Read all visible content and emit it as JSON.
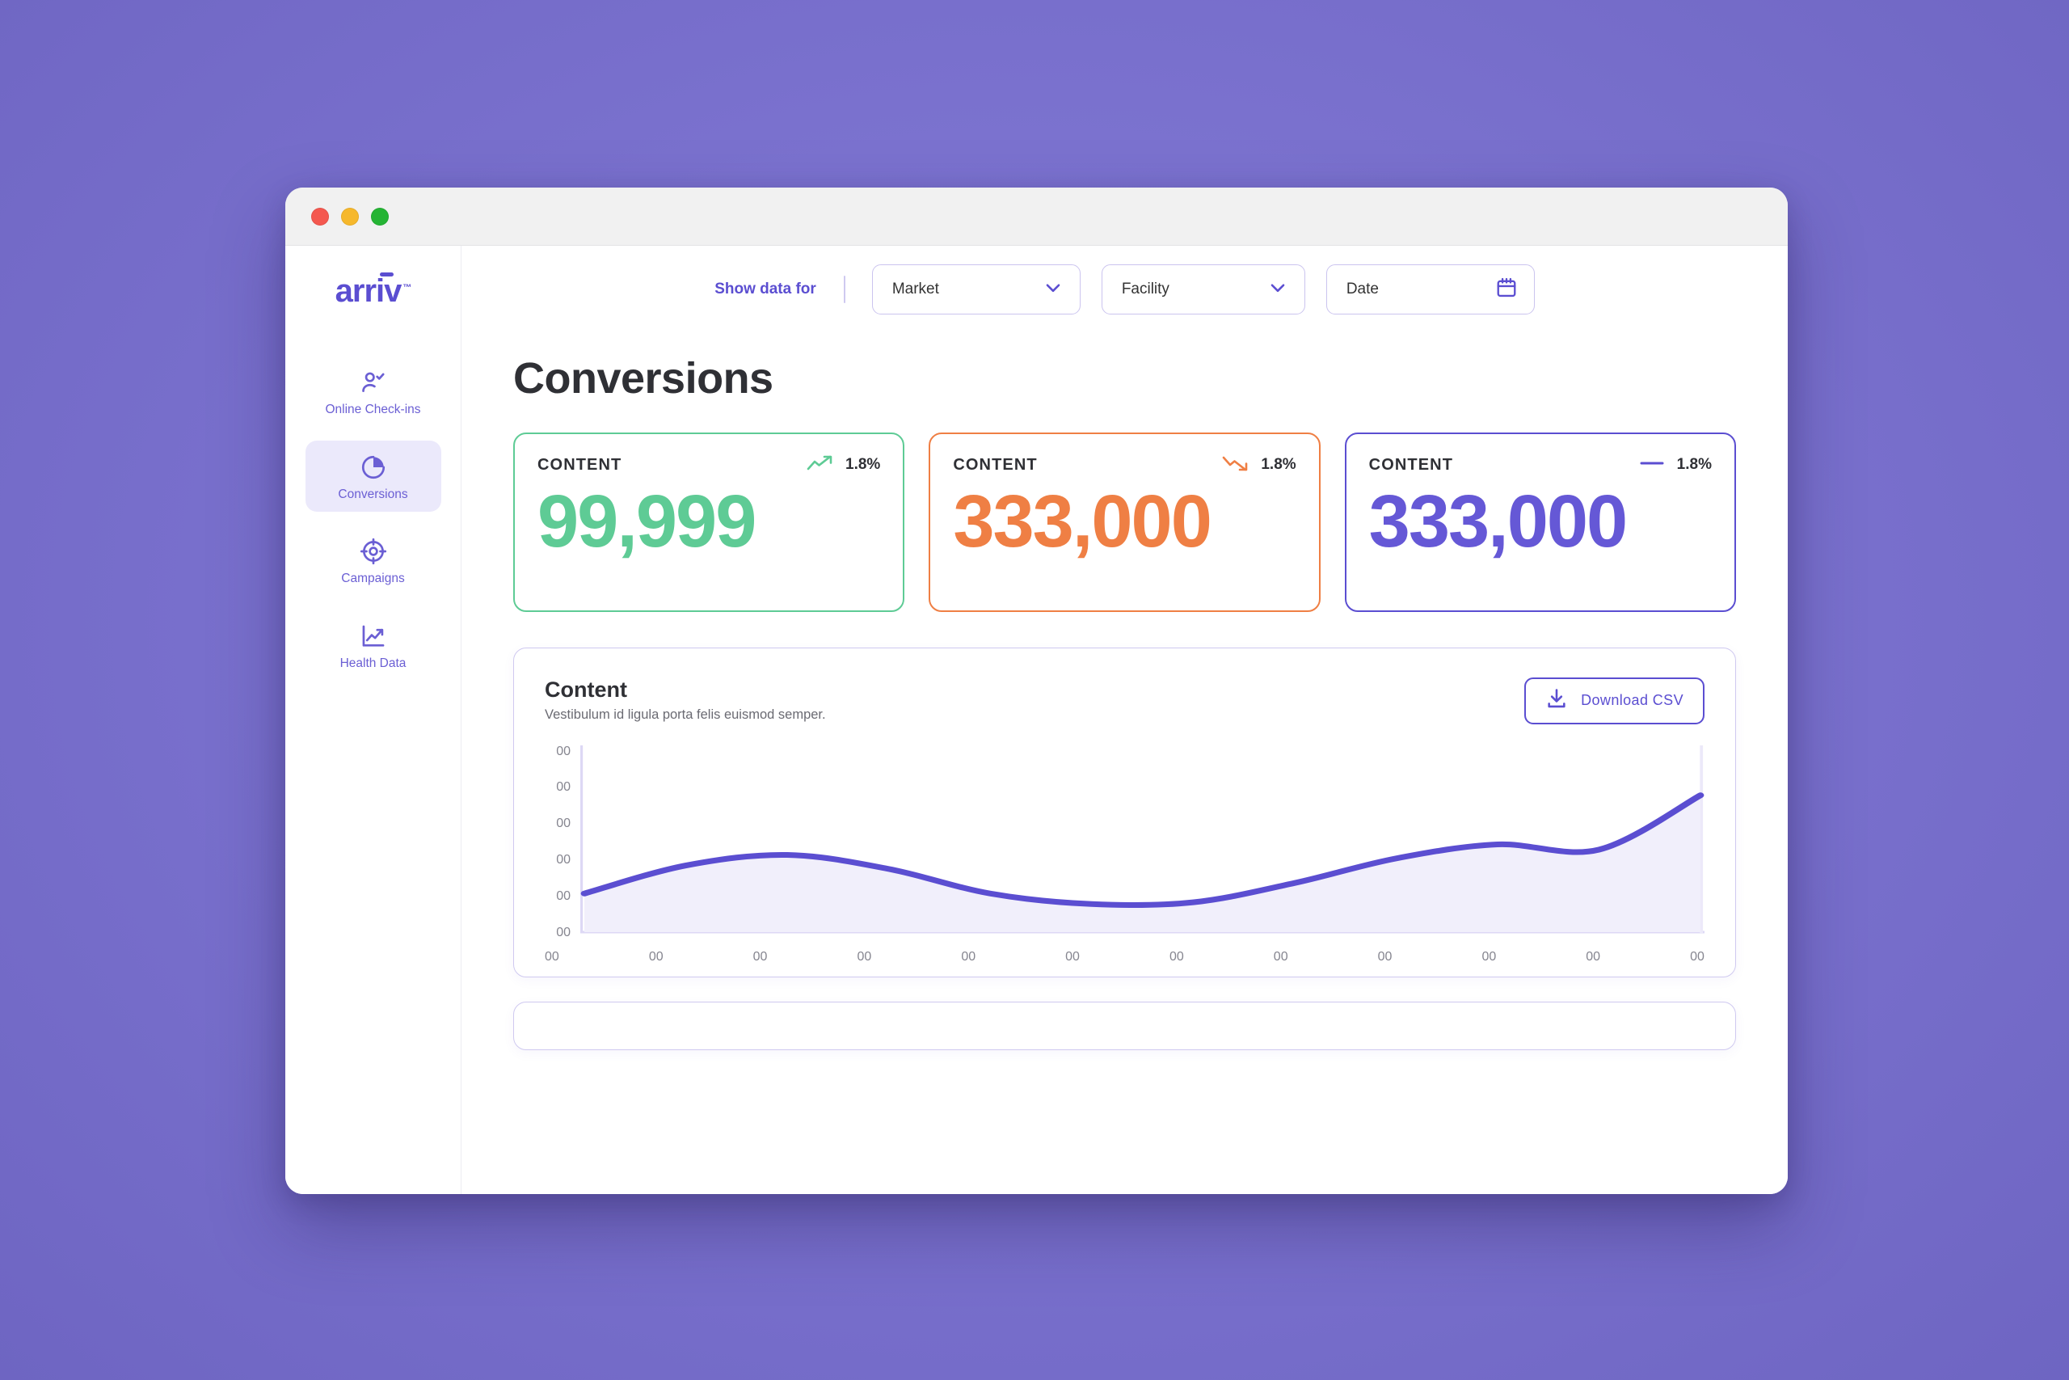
{
  "window": {
    "traffic_lights": [
      "close",
      "minimize",
      "zoom"
    ]
  },
  "brand": {
    "logo_text": "arriv",
    "logo_tm": "™"
  },
  "sidebar": {
    "items": [
      {
        "label": "Online Check-ins",
        "icon": "user-check-icon",
        "active": false
      },
      {
        "label": "Conversions",
        "icon": "pie-chart-icon",
        "active": true
      },
      {
        "label": "Campaigns",
        "icon": "target-icon",
        "active": false
      },
      {
        "label": "Health Data",
        "icon": "line-chart-icon",
        "active": false
      }
    ]
  },
  "topbar": {
    "show_data_for_label": "Show data for",
    "filters": [
      {
        "label": "Market",
        "icon": "chevron-down-icon"
      },
      {
        "label": "Facility",
        "icon": "chevron-down-icon"
      },
      {
        "label": "Date",
        "icon": "calendar-icon"
      }
    ]
  },
  "page": {
    "title": "Conversions"
  },
  "stat_cards": [
    {
      "title": "CONTENT",
      "value": "99,999",
      "delta": "1.8%",
      "trend": "up",
      "color": "#5ecb95"
    },
    {
      "title": "CONTENT",
      "value": "333,000",
      "delta": "1.8%",
      "trend": "down",
      "color": "#ef7f44"
    },
    {
      "title": "CONTENT",
      "value": "333,000",
      "delta": "1.8%",
      "trend": "neutral",
      "color": "#5b4ed1"
    }
  ],
  "chart_card": {
    "title": "Content",
    "subtitle": "Vestibulum id ligula porta felis euismod semper.",
    "download_button": {
      "label": "Download  CSV",
      "icon": "download-icon"
    }
  },
  "chart_data": {
    "type": "area",
    "title": "Content",
    "subtitle": "Vestibulum id ligula porta felis euismod semper.",
    "xlabel": "",
    "ylabel": "",
    "grid": false,
    "legend": null,
    "line_color": "#5b4ed1",
    "fill_color": "#f1effb",
    "x_tick_labels": [
      "00",
      "00",
      "00",
      "00",
      "00",
      "00",
      "00",
      "00",
      "00",
      "00",
      "00",
      "00"
    ],
    "y_tick_labels": [
      "00",
      "00",
      "00",
      "00",
      "00",
      "00"
    ],
    "ylim": [
      0,
      100
    ],
    "x": [
      0,
      1,
      2,
      3,
      4,
      5,
      6,
      7,
      8,
      9,
      10,
      11
    ],
    "values": [
      22,
      38,
      44,
      36,
      22,
      16,
      17,
      28,
      42,
      50,
      47,
      78
    ]
  },
  "colors": {
    "backdrop": "#7b72cf",
    "accent": "#5b4ed1",
    "accent_light": "#ebe9fb",
    "green": "#5ecb95",
    "orange": "#ef7f44",
    "text_dark": "#2f3035",
    "text_muted": "#6a6a72",
    "border_light": "#cfc9f0"
  }
}
